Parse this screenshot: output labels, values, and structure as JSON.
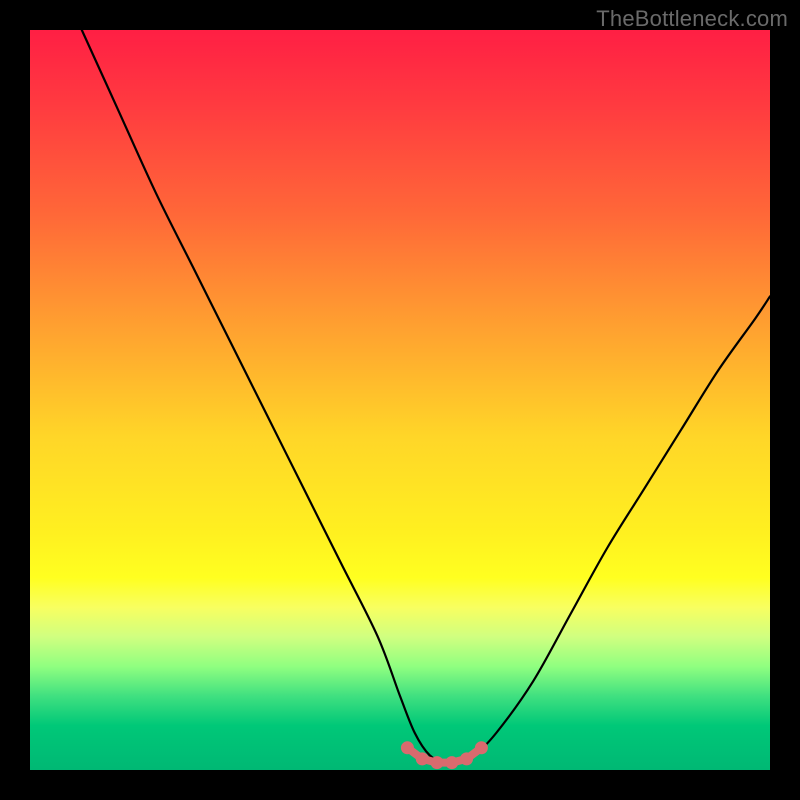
{
  "watermark": {
    "text": "TheBottleneck.com"
  },
  "colors": {
    "curve_stroke": "#000000",
    "marker_fill": "#d96a6e",
    "marker_stroke": "#d96a6e"
  },
  "chart_data": {
    "type": "line",
    "title": "",
    "xlabel": "",
    "ylabel": "",
    "xlim": [
      0,
      100
    ],
    "ylim": [
      0,
      100
    ],
    "grid": false,
    "legend_position": "none",
    "annotations": [
      "TheBottleneck.com"
    ],
    "series": [
      {
        "name": "bottleneck-curve",
        "x": [
          7,
          12,
          17,
          22,
          27,
          32,
          37,
          42,
          47,
          50,
          52,
          54,
          56,
          58,
          60,
          63,
          68,
          73,
          78,
          83,
          88,
          93,
          98,
          100
        ],
        "values": [
          100,
          89,
          78,
          68,
          58,
          48,
          38,
          28,
          18,
          10,
          5,
          2,
          1,
          1,
          2,
          5,
          12,
          21,
          30,
          38,
          46,
          54,
          61,
          64
        ]
      },
      {
        "name": "optimal-band-markers",
        "x": [
          51,
          53,
          55,
          57,
          59,
          61
        ],
        "values": [
          3.0,
          1.5,
          1.0,
          1.0,
          1.5,
          3.0
        ]
      }
    ]
  }
}
